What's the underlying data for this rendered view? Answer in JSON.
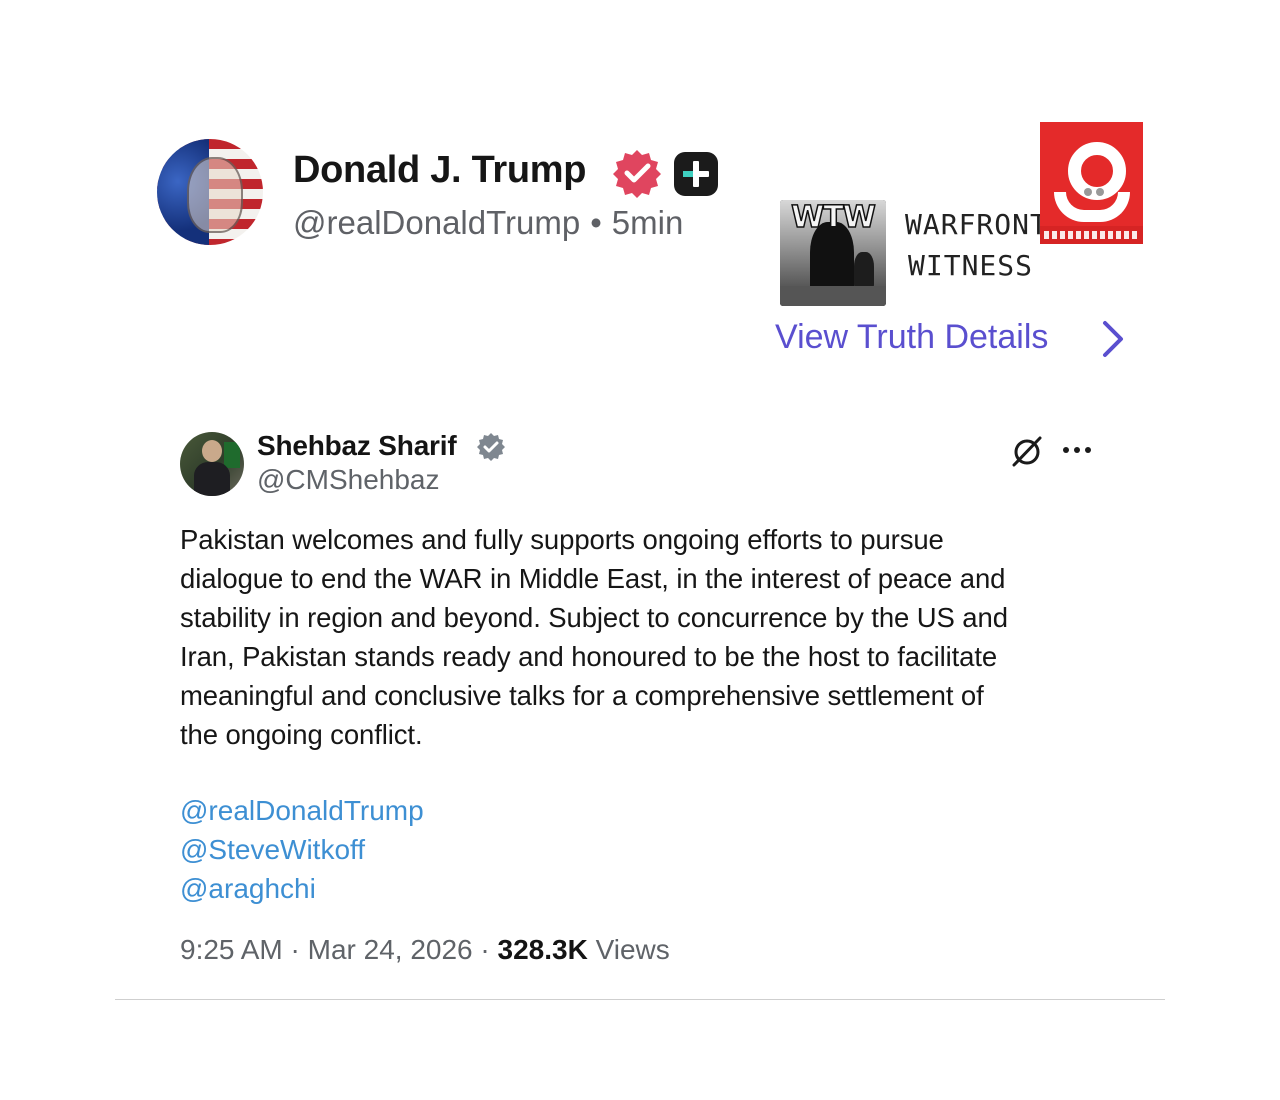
{
  "truth_post": {
    "author_name": "Donald J. Trump",
    "handle": "@realDonaldTrump",
    "separator": "•",
    "time_ago": "5min",
    "badge_colors": {
      "verified": "#e0455f",
      "plus": "#1b1b1b"
    }
  },
  "source": {
    "logo_text": "WTW",
    "name_line_1": "WARFRONT",
    "name_line_2": "WITNESS"
  },
  "view_details": {
    "label": "View Truth Details",
    "color": "#5a4fcf"
  },
  "embedded_post": {
    "author_name": "Shehbaz Sharif",
    "handle": "@CMShehbaz",
    "body_lines": [
      "Pakistan welcomes and fully supports ongoing efforts to pursue",
      "dialogue to end the WAR in Middle East, in the interest of peace and",
      "stability in region and beyond. Subject to concurrence by the US and",
      "Iran, Pakistan stands ready and honoured to be the host to facilitate",
      "meaningful and conclusive talks for a comprehensive settlement of",
      "the ongoing conflict."
    ],
    "mentions": [
      "@realDonaldTrump",
      "@SteveWitkoff",
      "@araghchi"
    ],
    "time": "9:25 AM",
    "date": "Mar 24, 2026",
    "views_count": "328.3K",
    "views_label": "Views",
    "meta_separator": "·",
    "mention_color": "#3d8fd3"
  },
  "icons": {
    "verified": "verified-badge-icon",
    "plus": "truth-plus-icon",
    "chevron": "chevron-right-icon",
    "grok": "grok-icon",
    "more": "more-options-icon"
  }
}
